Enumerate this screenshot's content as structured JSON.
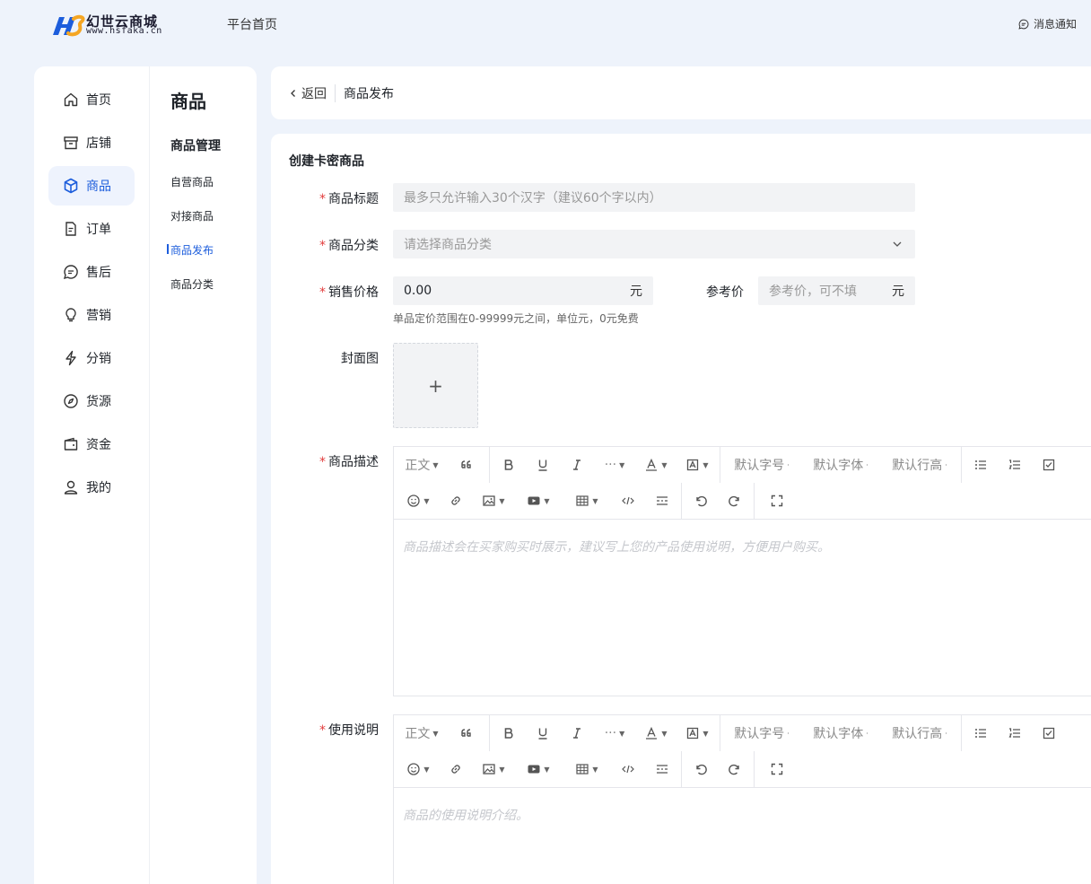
{
  "header": {
    "logo_name": "幻世云商城",
    "logo_url": "www.hsfaka.cn",
    "nav_home": "平台首页",
    "notice": "消息通知"
  },
  "sidebar": {
    "items": [
      {
        "label": "首页",
        "icon": "home-icon"
      },
      {
        "label": "店铺",
        "icon": "store-icon"
      },
      {
        "label": "商品",
        "icon": "box-icon",
        "active": true
      },
      {
        "label": "订单",
        "icon": "document-icon"
      },
      {
        "label": "售后",
        "icon": "chat-icon"
      },
      {
        "label": "营销",
        "icon": "bulb-icon"
      },
      {
        "label": "分销",
        "icon": "lightning-icon"
      },
      {
        "label": "货源",
        "icon": "compass-icon"
      },
      {
        "label": "资金",
        "icon": "wallet-icon"
      },
      {
        "label": "我的",
        "icon": "user-icon"
      }
    ]
  },
  "subnav": {
    "title": "商品",
    "group": "商品管理",
    "items": [
      "自营商品",
      "对接商品",
      "商品发布",
      "商品分类"
    ],
    "active": "商品发布"
  },
  "breadcrumb": {
    "back": "返回",
    "current": "商品发布"
  },
  "form": {
    "title": "创建卡密商品",
    "name_label": "商品标题",
    "name_placeholder": "最多只允许输入30个汉字（建议60个字以内）",
    "category_label": "商品分类",
    "category_placeholder": "请选择商品分类",
    "price_label": "销售价格",
    "price_value": "0.00",
    "price_unit": "元",
    "ref_label": "参考价",
    "ref_placeholder": "参考价，可不填",
    "ref_unit": "元",
    "price_hint": "单品定价范围在0-99999元之间，单位元，0元免费",
    "cover_label": "封面图",
    "cover_plus": "+",
    "desc_label": "商品描述",
    "desc_placeholder": "商品描述会在买家购买时展示，建议写上您的产品使用说明，方便用户购买。",
    "usage_label": "使用说明",
    "usage_placeholder": "商品的使用说明介绍。"
  },
  "toolbar": {
    "paragraph": "正文",
    "font_size": "默认字号",
    "font_family": "默认字体",
    "line_height": "默认行高",
    "more": "···"
  }
}
